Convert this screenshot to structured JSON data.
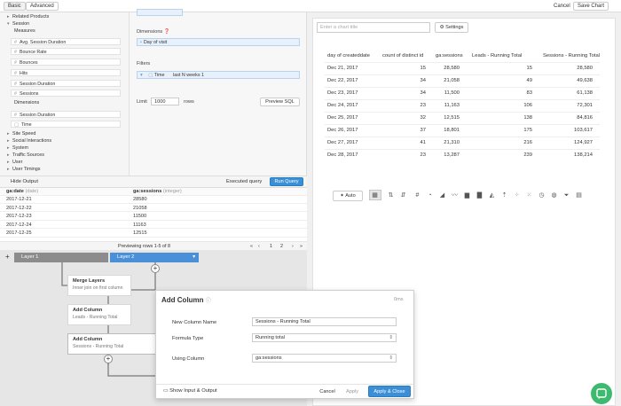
{
  "topbar": {
    "tabs": [
      "Basic",
      "Advanced"
    ],
    "cancel": "Cancel",
    "save": "Save Chart"
  },
  "tree": {
    "related_products": "Related Products",
    "session": "Session",
    "measures": "Measures",
    "measure_items": [
      "Avg. Session Duration",
      "Bounce Rate",
      "Bounces",
      "Hits",
      "Session Duration",
      "Sessions"
    ],
    "dimensions": "Dimensions",
    "dimension_items": [
      "Session Duration",
      "Time"
    ],
    "groups": [
      "Site Speed",
      "Social Interactions",
      "System",
      "Traffic Sources",
      "User",
      "User Timings"
    ]
  },
  "builder": {
    "dimensions_label": "Dimensions",
    "dimension_pill": "Day of visit",
    "filters_label": "Filters",
    "filter_field": "Time",
    "filter_value": "last N weeks 1",
    "limit_label": "Limit",
    "limit_value": "1000",
    "rows_label": "rows",
    "preview_sql": "Preview SQL"
  },
  "output": {
    "hide_output": "Hide Output",
    "executed_query": "Executed query",
    "run_query": "Run Query",
    "col1": "ga:date",
    "col1_type": "(date)",
    "col2": "ga:sessions",
    "col2_type": "(integer)",
    "rows": [
      [
        "2017-12-21",
        "28580"
      ],
      [
        "2017-12-22",
        "21058"
      ],
      [
        "2017-12-23",
        "11500"
      ],
      [
        "2017-12-24",
        "11163"
      ],
      [
        "2017-12-25",
        "12515"
      ]
    ],
    "previewing": "Previewing rows 1-5 of 8",
    "pages": [
      "1",
      "2"
    ]
  },
  "pipeline": {
    "layer1": "Layer 1",
    "layer2": "Layer 2",
    "nodes": [
      {
        "title": "Merge Layers",
        "sub": "Inner join on first column"
      },
      {
        "title": "Add Column",
        "sub": "Leads - Running Total"
      },
      {
        "title": "Add Column",
        "sub": "Sessions - Running Total"
      }
    ]
  },
  "modal": {
    "title": "Add Column",
    "timing": "0ms",
    "new_col_label": "New Column Name",
    "new_col_value": "Sessions - Running Total",
    "formula_label": "Formula Type",
    "formula_value": "Running total",
    "using_label": "Using Column",
    "using_value": "ga:sessions",
    "show_io": "Show Input & Output",
    "cancel": "Cancel",
    "apply": "Apply",
    "apply_close": "Apply & Close"
  },
  "chart": {
    "title_placeholder": "Enter a chart title",
    "settings": "Settings",
    "auto": "Auto",
    "headers": [
      "day of createddate",
      "count of distinct id",
      "ga:sessions",
      "Leads - Running Total",
      "Sessions - Running Total"
    ],
    "rows": [
      [
        "Dec 21, 2017",
        "15",
        "28,580",
        "15",
        "28,580"
      ],
      [
        "Dec 22, 2017",
        "34",
        "21,058",
        "49",
        "49,638"
      ],
      [
        "Dec 23, 2017",
        "34",
        "11,500",
        "83",
        "61,138"
      ],
      [
        "Dec 24, 2017",
        "23",
        "11,163",
        "106",
        "72,301"
      ],
      [
        "Dec 25, 2017",
        "32",
        "12,515",
        "138",
        "84,816"
      ],
      [
        "Dec 26, 2017",
        "37",
        "18,801",
        "175",
        "103,617"
      ],
      [
        "Dec 27, 2017",
        "41",
        "21,310",
        "216",
        "124,927"
      ],
      [
        "Dec 28, 2017",
        "23",
        "13,287",
        "239",
        "138,214"
      ]
    ]
  },
  "colors": {
    "accent": "#3a8fd6",
    "layer1": "#8c8c8c",
    "chat": "#3dba6f"
  }
}
